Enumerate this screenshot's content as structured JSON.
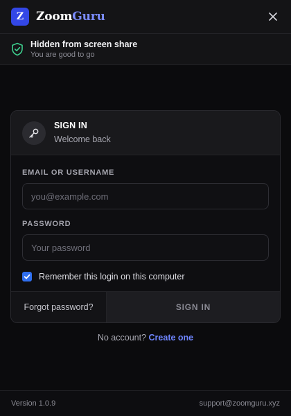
{
  "app": {
    "logo_letter": "Z",
    "brand_part1": "Zoom",
    "brand_part2": "Guru"
  },
  "status": {
    "title": "Hidden from screen share",
    "subtitle": "You are good to go",
    "icon": "shield-check-icon"
  },
  "card": {
    "title": "SIGN IN",
    "subtitle": "Welcome back",
    "icon": "key-icon"
  },
  "form": {
    "email_label": "EMAIL OR USERNAME",
    "email_placeholder": "you@example.com",
    "email_value": "",
    "password_label": "PASSWORD",
    "password_placeholder": "Your password",
    "password_value": "",
    "remember_label": "Remember this login on this computer",
    "remember_checked": true
  },
  "actions": {
    "forgot_label": "Forgot password?",
    "signin_label": "SIGN IN"
  },
  "signup": {
    "prompt": "No account?",
    "link": "Create one"
  },
  "footer": {
    "version": "Version 1.0.9",
    "support": "support@zoomguru.xyz"
  },
  "colors": {
    "accent": "#3347e6",
    "link": "#6f86ff",
    "status_green": "#3ecf8e",
    "checkbox": "#2f6ff0"
  }
}
